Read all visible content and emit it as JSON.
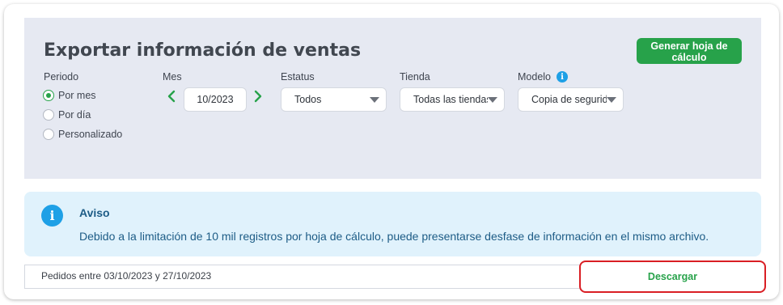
{
  "page": {
    "title": "Exportar información de ventas",
    "generate_button": "Generar hoja de cálculo"
  },
  "filters": {
    "period": {
      "label": "Periodo",
      "options": [
        {
          "label": "Por mes",
          "selected": true
        },
        {
          "label": "Por día",
          "selected": false
        },
        {
          "label": "Personalizado",
          "selected": false
        }
      ]
    },
    "month": {
      "label": "Mes",
      "value": "10/2023"
    },
    "status": {
      "label": "Estatus",
      "value": "Todos"
    },
    "store": {
      "label": "Tienda",
      "value": "Todas las tiendas"
    },
    "model": {
      "label": "Modelo",
      "value": "Copia de seguridad",
      "info_icon": "info-icon"
    }
  },
  "notice": {
    "title": "Aviso",
    "message": "Debido a la limitación de 10 mil registros por hoja de cálculo, puede presentarse desfase de información en el mismo archivo.",
    "icon": "info-icon"
  },
  "footer": {
    "range_text": "Pedidos entre 03/10/2023 y 27/10/2023",
    "download_button": "Descargar"
  },
  "colors": {
    "accent_green": "#27a24a",
    "panel_bg": "#e6e9f2",
    "notice_bg": "#e0f2fc",
    "info_blue": "#1ea0e6",
    "highlight_red": "#d91e24"
  }
}
